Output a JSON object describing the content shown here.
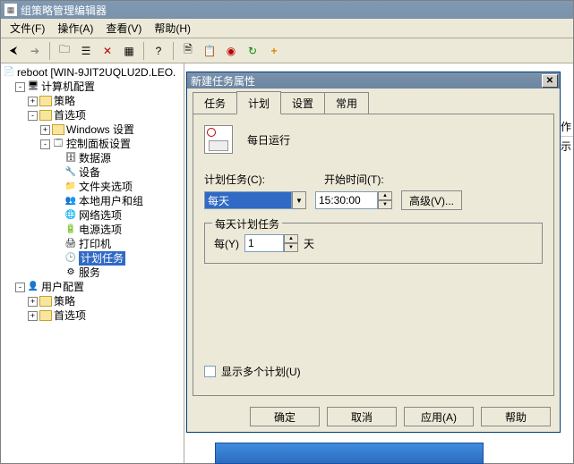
{
  "window": {
    "title": "组策略管理编辑器"
  },
  "menu": {
    "file": "文件(F)",
    "action": "操作(A)",
    "view": "查看(V)",
    "help": "帮助(H)"
  },
  "tree": {
    "root": "reboot [WIN-9JIT2UQLU2D.LEO.",
    "computer_config": "计算机配置",
    "policies": "策略",
    "preferences": "首选项",
    "windows_settings": "Windows 设置",
    "control_panel": "控制面板设置",
    "data_sources": "数据源",
    "devices": "设备",
    "folder_options": "文件夹选项",
    "local_users": "本地用户和组",
    "network_options": "网络选项",
    "power_options": "电源选项",
    "printers": "打印机",
    "scheduled_tasks": "计划任务",
    "services": "服务",
    "user_config": "用户配置",
    "u_policies": "策略",
    "u_preferences": "首选项"
  },
  "right": {
    "col1": "操作",
    "col2": "显示的"
  },
  "dialog": {
    "title": "新建任务属性",
    "tabs": {
      "task": "任务",
      "schedule": "计划",
      "settings": "设置",
      "common": "常用"
    },
    "daily_run": "每日运行",
    "sched_task_label": "计划任务(C):",
    "start_time_label": "开始时间(T):",
    "combo_value": "每天",
    "start_time": "15:30:00",
    "advanced": "高级(V)...",
    "group_title": "每天计划任务",
    "every_label": "每(Y)",
    "every_value": "1",
    "days_label": "天",
    "multi_sched": "显示多个计划(U)",
    "ok": "确定",
    "cancel": "取消",
    "apply": "应用(A)",
    "help": "帮助"
  }
}
